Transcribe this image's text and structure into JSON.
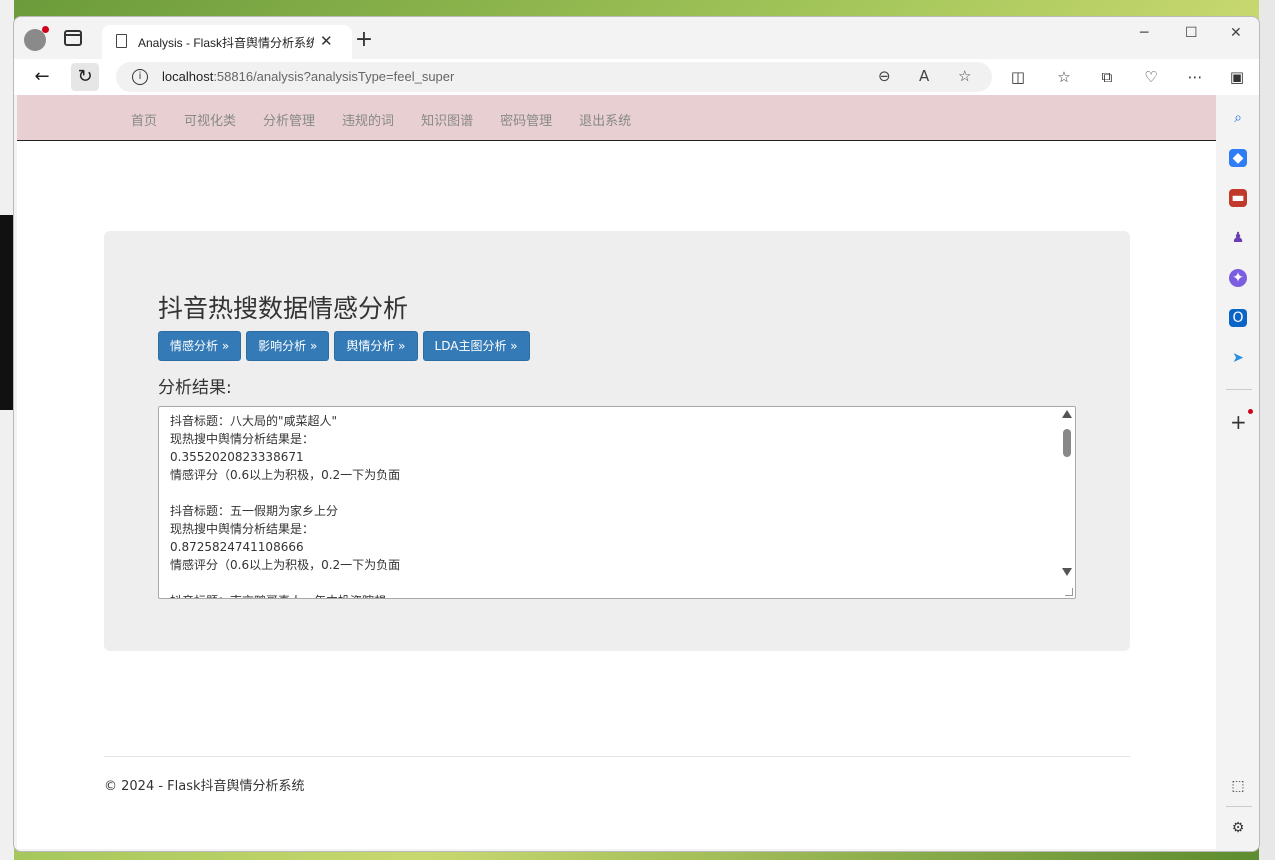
{
  "browser": {
    "tab_title": "Analysis - Flask抖音舆情分析系统",
    "url_host": "localhost",
    "url_rest": ":58816/analysis?analysisType=feel_super"
  },
  "nav": {
    "items": [
      "首页",
      "可视化类",
      "分析管理",
      "违规的词",
      "知识图谱",
      "密码管理",
      "退出系统"
    ]
  },
  "main": {
    "title": "抖音热搜数据情感分析",
    "buttons": [
      "情感分析 »",
      "影响分析 »",
      "舆情分析 »",
      "LDA主图分析 »"
    ],
    "result_label": "分析结果:",
    "result_text": "抖音标题：八大局的\"咸菜超人\"\n现热搜中舆情分析结果是：\n0.3552020823338671\n情感评分（0.6以上为积极，0.2一下为负面\n\n抖音标题：五一假期为家乡上分\n现热搜中舆情分析结果是：\n0.8725824741108666\n情感评分（0.6以上为积极，0.2一下为负面\n\n抖音标题：南京鸭哥真人，年中投资瞎想"
  },
  "footer": {
    "text": "© 2024 - Flask抖音舆情分析系统"
  }
}
